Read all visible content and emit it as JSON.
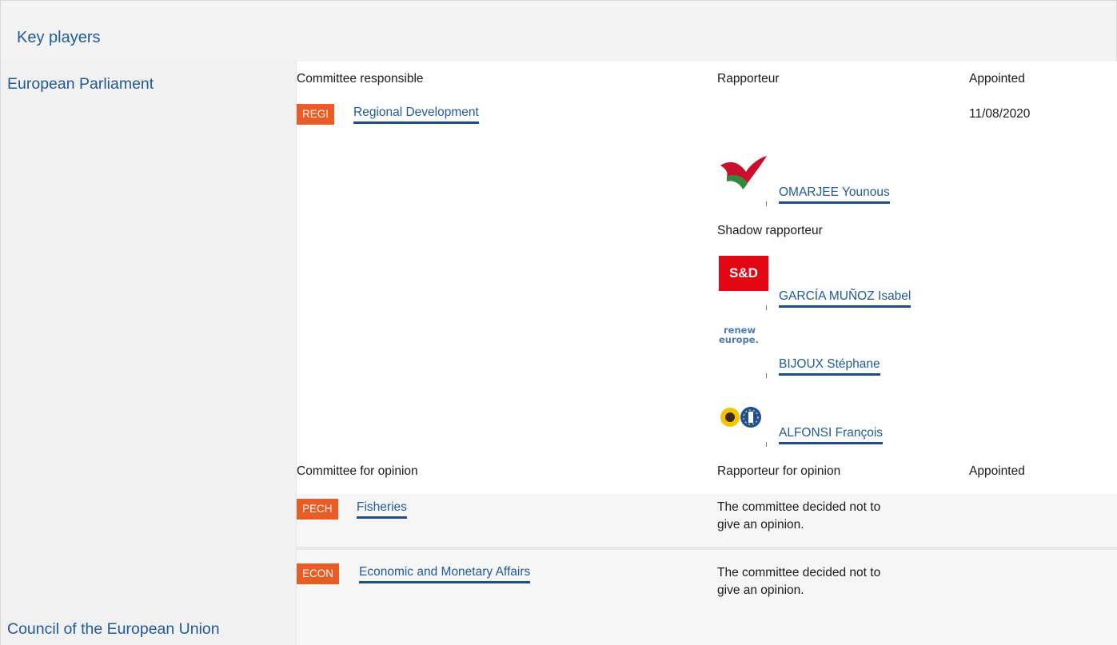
{
  "section": {
    "title": "Key players"
  },
  "left": {
    "parliament_label": "European Parliament",
    "council_label": "Council of the European Union"
  },
  "responsible": {
    "col_committee": "Committee responsible",
    "col_rapporteur": "Rapporteur",
    "col_appointed": "Appointed",
    "committee_code": "REGI",
    "committee_name": "Regional Development",
    "appointed_date": "11/08/2020",
    "rapporteur_name": "OMARJEE Younous",
    "shadow_label": "Shadow rapporteur",
    "shadows": [
      {
        "name": "GARCÍA MUÑOZ Isabel",
        "logo": "S&D"
      },
      {
        "name": "BIJOUX Stéphane",
        "logo": "renew europe."
      },
      {
        "name": "ALFONSI François",
        "logo": "greens-efa-icon"
      }
    ]
  },
  "opinion": {
    "col_committee": "Committee for opinion",
    "col_rapporteur": "Rapporteur for opinion",
    "col_appointed": "Appointed",
    "rows": [
      {
        "code": "PECH",
        "name": "Fisheries",
        "note": "The committee decided not to give an opinion."
      },
      {
        "code": "ECON",
        "name": "Economic and Monetary Affairs",
        "note": "The committee decided not to give an opinion."
      }
    ]
  },
  "colors": {
    "link": "#1f5a99",
    "badge": "#e85c25",
    "sd_red": "#e30613"
  }
}
